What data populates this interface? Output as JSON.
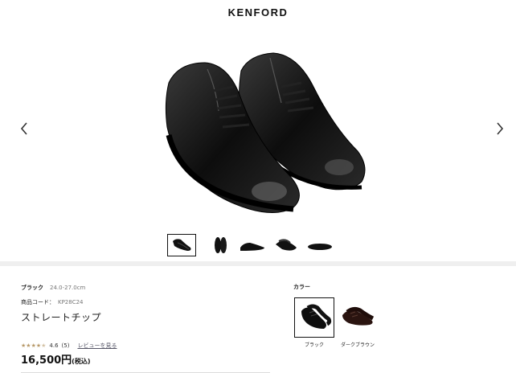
{
  "header": {
    "brand": "KENFORD"
  },
  "gallery": {
    "prev_icon": "chevron-left-icon",
    "next_icon": "chevron-right-icon",
    "thumbnail_count": 5,
    "active_thumbnail": 1
  },
  "product": {
    "color_name": "ブラック",
    "size_range": "24.0-27.0cm",
    "code_label": "商品コード：",
    "code_value": "KP28C24",
    "name": "ストレートチップ",
    "rating": {
      "stars_filled": 4.5,
      "score": "4.6",
      "count": "(5)",
      "review_link": "レビューを見る"
    },
    "price": "16,500円",
    "tax_label": "(税込)"
  },
  "colors": {
    "label": "カラー",
    "options": [
      {
        "name": "ブラック",
        "selected": true
      },
      {
        "name": "ダークブラウン",
        "selected": false
      }
    ]
  },
  "theme": {
    "star_color": "#b89a6a",
    "divider_color": "#efefef"
  }
}
